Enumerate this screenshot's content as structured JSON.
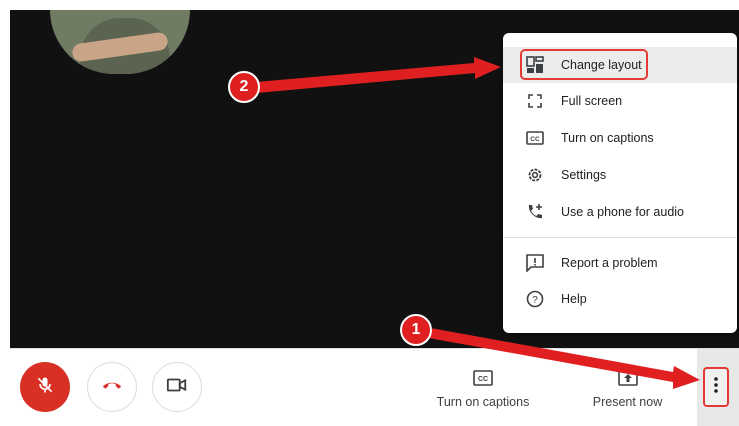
{
  "menu": {
    "items": [
      {
        "label": "Change layout",
        "icon": "change-layout-icon",
        "highlighted": true
      },
      {
        "label": "Full screen",
        "icon": "fullscreen-icon"
      },
      {
        "label": "Turn on captions",
        "icon": "captions-icon"
      },
      {
        "label": "Settings",
        "icon": "settings-gear-icon"
      },
      {
        "label": "Use a phone for audio",
        "icon": "phone-add-icon"
      },
      {
        "label": "Report a problem",
        "icon": "report-problem-icon"
      },
      {
        "label": "Help",
        "icon": "help-icon"
      }
    ]
  },
  "toolbar": {
    "mic_icon": "mic-off-icon",
    "hangup_icon": "hangup-phone-icon",
    "camera_icon": "camera-icon",
    "captions_label": "Turn on captions",
    "present_label": "Present now",
    "more_icon": "more-vert-icon"
  },
  "annotations": {
    "badge_1": "1",
    "badge_2": "2"
  },
  "colors": {
    "accent_red": "#e53935",
    "mic_red": "#d93025",
    "stage_bg": "#111111"
  }
}
